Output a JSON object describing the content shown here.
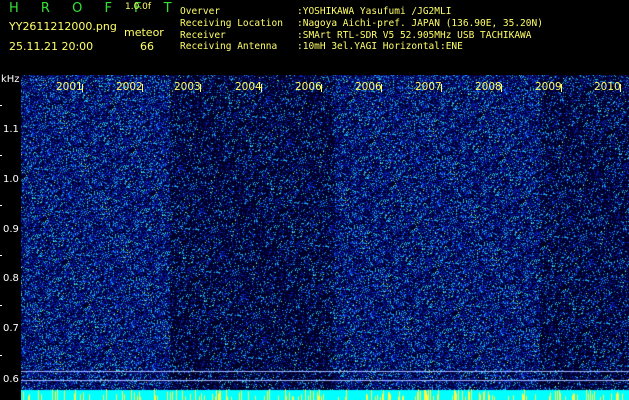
{
  "header": {
    "title": "H R O F F T",
    "version": "1.0.0f",
    "filename": "YY2611212000.png",
    "meteor_label": "meteor",
    "datetime": "25.11.21 20:00",
    "meteor_count": "66"
  },
  "info": [
    {
      "key": "Overver",
      "value": ":YOSHIKAWA Yasufumi /JG2MLI"
    },
    {
      "key": "Receiving Location",
      "value": ":Nagoya Aichi-pref. JAPAN (136.90E, 35.20N)"
    },
    {
      "key": "Receiver",
      "value": ":SMArt RTL-SDR V5 52.905MHz USB TACHIKAWA"
    },
    {
      "key": "Receiving Antenna",
      "value": ":10mH 3el.YAGI Horizontal:ENE"
    }
  ],
  "axis": {
    "unit": "kHz",
    "ticks": [
      "1.1",
      "1.0",
      "0.9",
      "0.8",
      "0.7",
      "0.6"
    ]
  },
  "time_labels": [
    "2001",
    "2002",
    "2003",
    "2004",
    "2006",
    "2006",
    "2007",
    "2008",
    "2009",
    "2010"
  ],
  "colors": {
    "background": "#000000",
    "spectrum_noise": "#0a1ad0",
    "signal": "#00ffff",
    "label_yellow": "#ffff6a",
    "label_green": "#34e234"
  }
}
